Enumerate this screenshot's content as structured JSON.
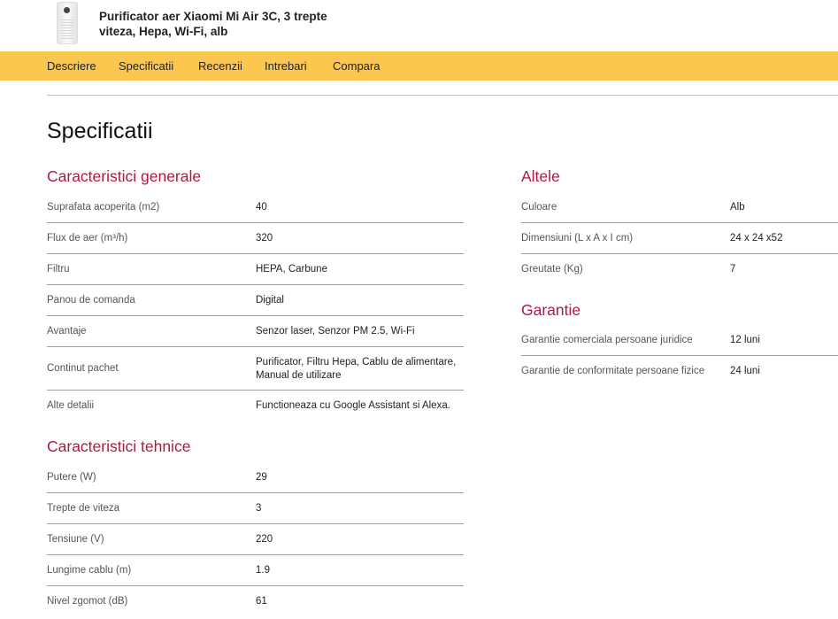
{
  "product": {
    "title": "Purificator aer Xiaomi Mi Air 3C, 3 trepte viteza, Hepa, Wi-Fi, alb",
    "thumbnail_icon": "air-purifier-image"
  },
  "nav": {
    "items": [
      "Descriere",
      "Specificatii",
      "Recenzii",
      "Intrebari",
      "Compara"
    ],
    "bar_color": "#fcc74e"
  },
  "page": {
    "title": "Specificatii",
    "accent_color": "#b0193f"
  },
  "sections": {
    "general": {
      "title": "Caracteristici generale",
      "rows": [
        {
          "label": "Suprafata acoperita (m2)",
          "value": "40"
        },
        {
          "label": "Flux de aer (m³/h)",
          "value": "320"
        },
        {
          "label": "Filtru",
          "value": "HEPA, Carbune"
        },
        {
          "label": "Panou de comanda",
          "value": "Digital"
        },
        {
          "label": "Avantaje",
          "value": "Senzor laser, Senzor PM 2.5, Wi-Fi"
        },
        {
          "label": "Continut pachet",
          "value": "Purificator, Filtru Hepa, Cablu de alimentare, Manual de utilizare"
        },
        {
          "label": "Alte detalii",
          "value": "Functioneaza cu Google Assistant si Alexa."
        }
      ]
    },
    "technical": {
      "title": "Caracteristici tehnice",
      "rows": [
        {
          "label": "Putere (W)",
          "value": "29"
        },
        {
          "label": "Trepte de viteza",
          "value": "3"
        },
        {
          "label": "Tensiune (V)",
          "value": "220"
        },
        {
          "label": "Lungime cablu (m)",
          "value": "1.9"
        },
        {
          "label": "Nivel zgomot (dB)",
          "value": "61"
        }
      ]
    },
    "other": {
      "title": "Altele",
      "rows": [
        {
          "label": "Culoare",
          "value": "Alb"
        },
        {
          "label": "Dimensiuni (L x A x I cm)",
          "value": "24 x 24 x52"
        },
        {
          "label": "Greutate (Kg)",
          "value": "7"
        }
      ]
    },
    "warranty": {
      "title": "Garantie",
      "rows": [
        {
          "label": "Garantie comerciala persoane juridice",
          "value": "12 luni"
        },
        {
          "label": "Garantie de conformitate persoane fizice",
          "value": "24 luni"
        }
      ]
    }
  }
}
